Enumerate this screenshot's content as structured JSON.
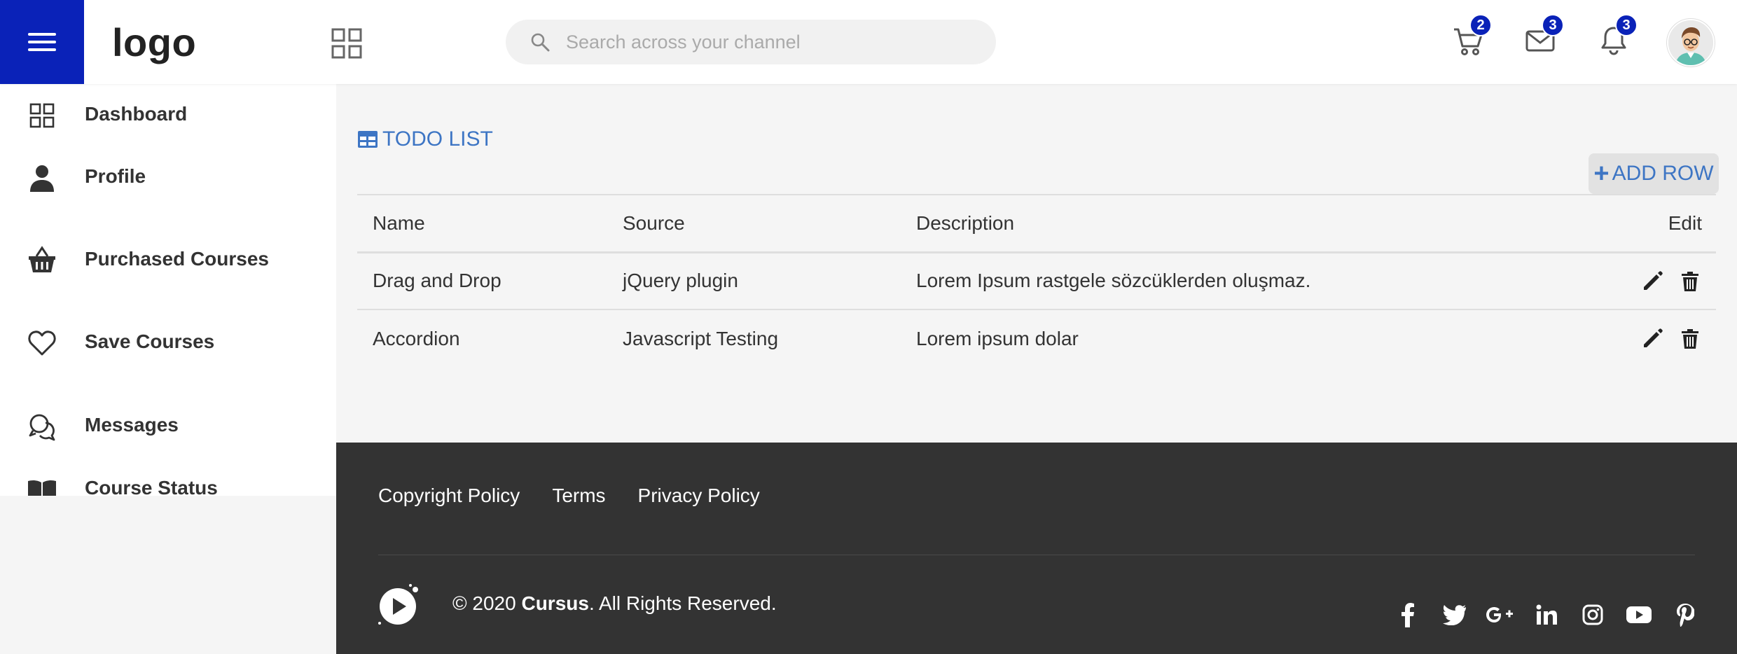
{
  "header": {
    "logo": "logo",
    "search_placeholder": "Search across your channel",
    "cart_badge": "2",
    "messages_badge": "3",
    "notifications_badge": "3",
    "accent_color": "#0a22b8"
  },
  "sidebar": {
    "items": [
      {
        "label": "Dashboard",
        "icon": "grid-icon"
      },
      {
        "label": "Profile",
        "icon": "person-icon"
      },
      {
        "label": "Purchased Courses",
        "icon": "basket-icon"
      },
      {
        "label": "Save Courses",
        "icon": "heart-icon"
      },
      {
        "label": "Messages",
        "icon": "chat-icon"
      },
      {
        "label": "Course Status",
        "icon": "book-icon"
      }
    ]
  },
  "main": {
    "title": "TODO LIST",
    "add_row_label": "ADD ROW",
    "table": {
      "headers": [
        "Name",
        "Source",
        "Description",
        "Edit"
      ],
      "rows": [
        {
          "name": "Drag and Drop",
          "source": "jQuery plugin",
          "description": "Lorem Ipsum rastgele sözcüklerden oluşmaz."
        },
        {
          "name": "Accordion",
          "source": "Javascript Testing",
          "description": "Lorem ipsum dolar"
        }
      ]
    }
  },
  "footer": {
    "links": [
      "Copyright Policy",
      "Terms",
      "Privacy Policy"
    ],
    "copyright_prefix": "© 2020 ",
    "brand": "Cursus",
    "copyright_suffix": ". All Rights Reserved.",
    "socials": [
      "facebook-icon",
      "twitter-icon",
      "google-plus-icon",
      "linkedin-icon",
      "instagram-icon",
      "youtube-icon",
      "pinterest-icon"
    ]
  }
}
